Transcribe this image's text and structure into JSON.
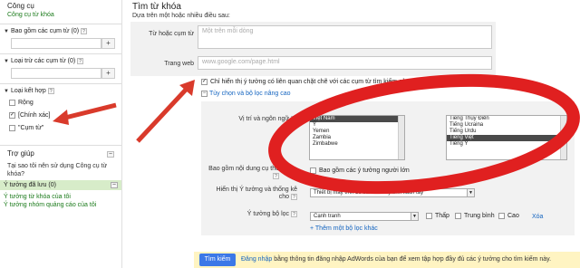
{
  "sidebar": {
    "title": "Công cụ",
    "tool_link": "Công cụ từ khóa",
    "include_head": "Bao gồm các cụm từ (0)",
    "exclude_head": "Loại trừ các cụm từ (0)",
    "plus": "+",
    "match_head": "Loại kết hợp",
    "match_options": [
      {
        "label": "Rộng",
        "checked": false
      },
      {
        "label": "[Chính xác]",
        "checked": true
      },
      {
        "label": "\"Cụm từ\"",
        "checked": false
      }
    ],
    "help_title": "Trợ giúp",
    "help_text": "Tại sao tôi nên sử dụng Công cụ từ khóa?",
    "saved_head": "Ý tưởng đã lưu (0)",
    "saved_links": [
      "Ý tưởng từ khóa của tôi",
      "Ý tưởng nhóm quảng cáo của tôi"
    ],
    "minimize": "–"
  },
  "main": {
    "title": "Tìm từ khóa",
    "subtitle": "Dựa trên một hoặc nhiều điều sau:",
    "keyword_label": "Từ hoặc cụm từ",
    "keyword_placeholder": "Một trên mỗi dòng",
    "website_label": "Trang web",
    "website_placeholder": "www.google.com/page.html",
    "only_related": "Chỉ hiển thị ý tưởng có liên quan chặt chẽ với các cụm từ tìm kiếm của tôi",
    "advanced_link": "Tùy chọn và bộ lọc nâng cao",
    "loc_label": "Vị trí và ngôn ngữ",
    "locations": [
      {
        "name": "Việt Nam",
        "selected": true
      },
      {
        "name": "Ý",
        "selected": false
      },
      {
        "name": "Yemen",
        "selected": false
      },
      {
        "name": "Zambia",
        "selected": false
      },
      {
        "name": "Zimbabwe",
        "selected": false
      }
    ],
    "languages": [
      {
        "name": "Tiếng Thụy Điển",
        "selected": false
      },
      {
        "name": "Tiếng Ucraina",
        "selected": false
      },
      {
        "name": "Tiếng Urdu",
        "selected": false
      },
      {
        "name": "Tiếng Việt",
        "selected": true
      },
      {
        "name": "Tiếng Ý",
        "selected": false
      }
    ],
    "adult_label": "Bao gồm nội dung cụ thể",
    "adult_option": "Bao gồm các ý tưởng người lớn",
    "show_label": "Hiển thị Ý tưởng và thống kê cho",
    "show_value": "Thiết bị máy tính để bàn và máy tính xách tay",
    "filter_label": "Ý tưởng bộ lọc",
    "filter_value": "Cạnh tranh",
    "filter_levels": [
      "Thấp",
      "Trung bình",
      "Cao"
    ],
    "filter_delete": "Xóa",
    "add_filter": "+ Thêm một bộ lọc khác",
    "search_button": "Tìm kiếm",
    "signin_link": "Đăng nhập",
    "signin_text": "bằng thông tin đăng nhập AdWords của bạn để xem tập hợp đầy đủ các ý tưởng cho tìm kiếm này."
  },
  "colors": {
    "annotation_red": "#e02020",
    "link_blue": "#1565c0",
    "link_green": "#1a7a1a",
    "search_button": "#3b78e7"
  }
}
